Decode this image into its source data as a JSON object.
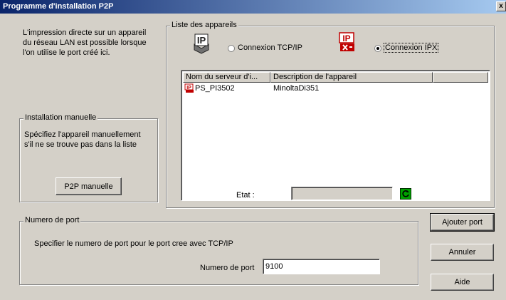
{
  "window": {
    "title": "Programme d'installation P2P",
    "close_label": "x"
  },
  "intro_text": "L'impression directe sur un appareil du réseau LAN est possible lorsque l'on utilise le port créé ici.",
  "manual": {
    "legend": "Installation manuelle",
    "description": "Spécifiez l'appareil manuellement s'il ne se trouve pas dans la liste",
    "button": "P2P manuelle"
  },
  "devices": {
    "legend": "Liste des appareils",
    "tcp_label": "Connexion TCP/IP",
    "ipx_label": "Connexion IPX",
    "selected": "ipx",
    "columns": [
      "Nom du serveur d'i...",
      "Description de l'appareil"
    ],
    "rows": [
      {
        "name": "PS_PI3502",
        "description": "MinoltaDi351"
      }
    ],
    "status_label": "Etat :"
  },
  "port": {
    "legend": "Numero de port",
    "description": "Specifier le numero de port pour le port cree avec TCP/IP",
    "field_label": "Numero de port",
    "value": "9100"
  },
  "actions": {
    "add": "Ajouter port",
    "cancel": "Annuler",
    "help": "Aide"
  },
  "icons": {
    "tcp": "ip-network-icon",
    "ipx": "ipx-network-icon",
    "refresh": "refresh-icon",
    "printer": "printer-icon"
  }
}
